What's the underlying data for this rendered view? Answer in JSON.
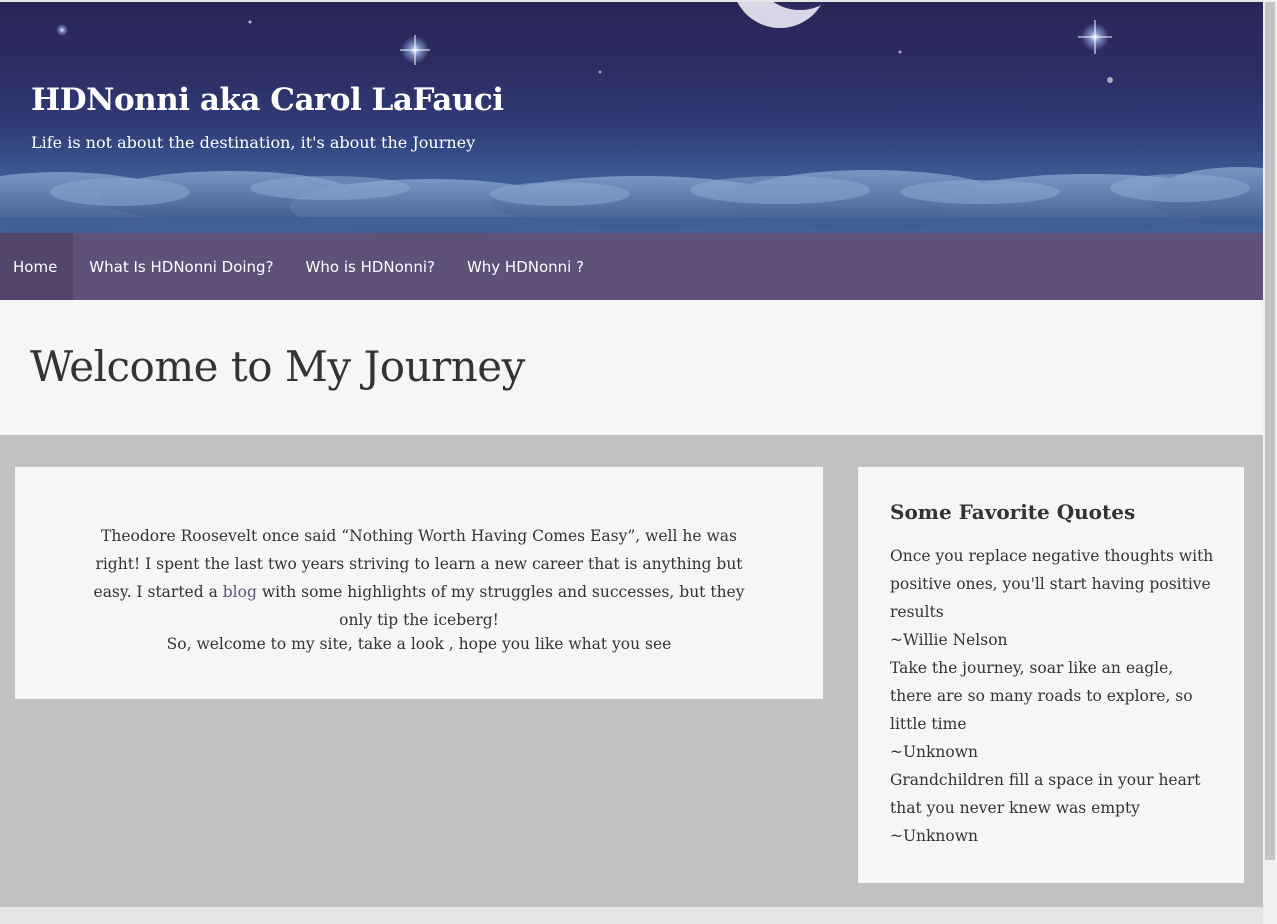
{
  "header": {
    "site_title": "HDNonni aka Carol LaFauci",
    "tagline": "Life is not about the destination, it's about the Journey"
  },
  "nav": {
    "items": [
      {
        "label": "Home",
        "active": true
      },
      {
        "label": "What Is HDNonni Doing?",
        "active": false
      },
      {
        "label": "Who is HDNonni?",
        "active": false
      },
      {
        "label": "Why HDNonni ?",
        "active": false
      }
    ]
  },
  "page": {
    "title": "Welcome to My Journey"
  },
  "main": {
    "intro_before_link": "Theodore Roosevelt once said “Nothing Worth Having Comes Easy”, well he was right! I spent the last two years striving to learn a new career that is anything but easy. I started a ",
    "link_text": "blog",
    "intro_after_link": " with some highlights of my struggles and successes, but they only tip the iceberg!",
    "welcome": "So, welcome to my site, take a look , hope you like what you see"
  },
  "sidebar": {
    "title": "Some Favorite Quotes",
    "quotes": [
      {
        "text": "Once you replace negative thoughts with positive ones, you'll start having positive results",
        "author": "~Willie Nelson"
      },
      {
        "text": "Take the journey, soar like an eagle, there are so many roads to explore, so little time",
        "author": "~Unknown"
      },
      {
        "text": "Grandchildren fill a space in your heart that you never knew was empty",
        "author": "~Unknown"
      }
    ]
  },
  "colors": {
    "nav_bg": "#5e5078",
    "nav_active_bg": "#524569",
    "content_bg": "#c1c1c1",
    "card_bg": "#f6f6f6",
    "link": "#5e5078"
  }
}
